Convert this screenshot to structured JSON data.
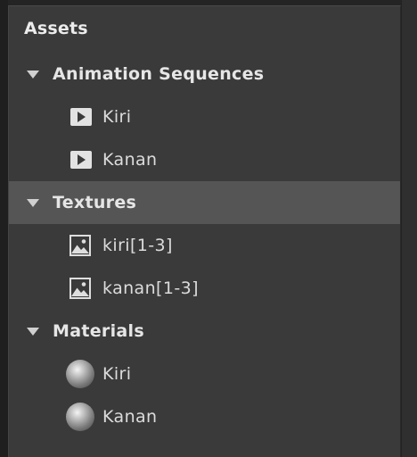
{
  "panel": {
    "title": "Assets"
  },
  "groups": [
    {
      "label": "Animation Sequences",
      "items": [
        {
          "label": "Kiri",
          "icon": "sequence-play-icon"
        },
        {
          "label": "Kanan",
          "icon": "sequence-play-icon"
        }
      ]
    },
    {
      "label": "Textures",
      "selected": true,
      "items": [
        {
          "label": "kiri[1-3]",
          "icon": "image-icon"
        },
        {
          "label": "kanan[1-3]",
          "icon": "image-icon"
        }
      ]
    },
    {
      "label": "Materials",
      "items": [
        {
          "label": "Kiri",
          "icon": "material-sphere-icon"
        },
        {
          "label": "Kanan",
          "icon": "material-sphere-icon"
        }
      ]
    }
  ]
}
